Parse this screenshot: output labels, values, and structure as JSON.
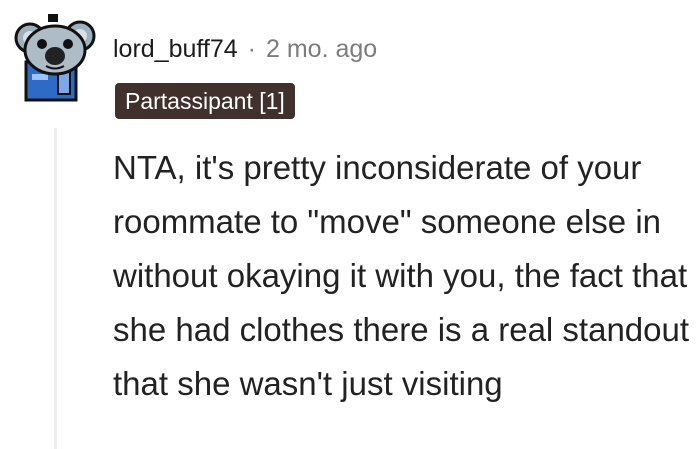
{
  "comment": {
    "username": "lord_buff74",
    "separator": "·",
    "timestamp": "2 mo. ago",
    "flair": "Partassipant [1]",
    "body": "NTA, it's pretty inconsiderate of your roommate to \"move\" someone else in without okaying it with you, the fact that she had clothes there is a real standout that she wasn't just visiting"
  },
  "colors": {
    "flair_background": "#41312d",
    "flair_text": "#ffffff",
    "meta_muted": "#7c7c7c",
    "avatar_background": "#2e6bc4"
  },
  "avatar": {
    "icon": "koala-snoo-avatar-icon"
  }
}
